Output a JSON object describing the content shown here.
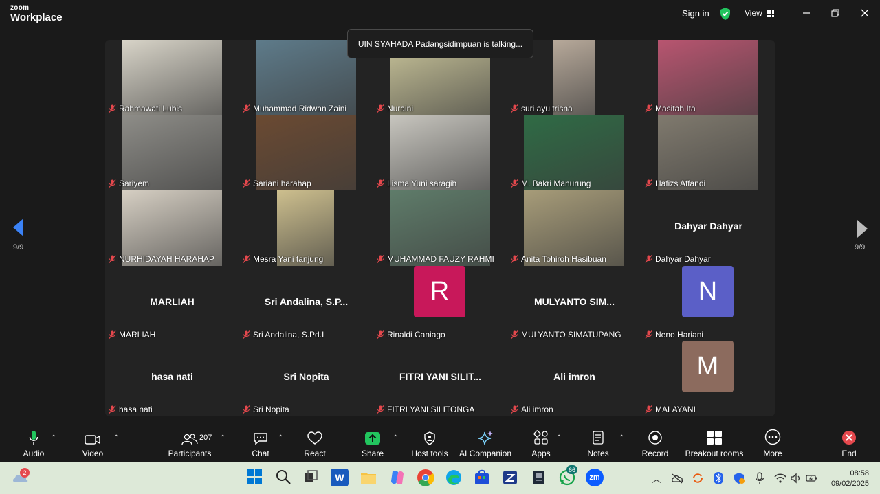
{
  "titlebar": {
    "logo_top": "zoom",
    "logo_bottom": "Workplace",
    "signin": "Sign in",
    "view": "View"
  },
  "toast": "UIN SYAHADA Padangsidimpuan is talking...",
  "pager": {
    "left": "9/9",
    "right": "9/9"
  },
  "tiles": [
    {
      "label": "Rahmawati Lubis",
      "kind": "video",
      "color": "#d8d4c8"
    },
    {
      "label": "Muhammad Ridwan Zaini",
      "kind": "video",
      "color": "#5e7b8a"
    },
    {
      "label": "Nuraini",
      "kind": "video",
      "color": "#c9c49a"
    },
    {
      "label": "suri ayu trisna",
      "kind": "video",
      "color": "#b7a99a"
    },
    {
      "label": "Masitah Ita",
      "kind": "video",
      "color": "#b85570"
    },
    {
      "label": "Sariyem",
      "kind": "video",
      "color": "#8e8d88"
    },
    {
      "label": "Sariani harahap",
      "kind": "video",
      "color": "#6b4a32"
    },
    {
      "label": "Lisma Yuni saragih",
      "kind": "video",
      "color": "#c8c6bf"
    },
    {
      "label": "M. Bakri Manurung",
      "kind": "video",
      "color": "#2f6b45"
    },
    {
      "label": "Hafizs Affandi",
      "kind": "video",
      "color": "#807a6e"
    },
    {
      "label": "NURHIDAYAH HARAHAP",
      "kind": "video",
      "color": "#d6cfc3"
    },
    {
      "label": "Mesra Yani tanjung",
      "kind": "video",
      "color": "#cdbf8e"
    },
    {
      "label": "MUHAMMAD FAUZY RAHMI",
      "kind": "video",
      "color": "#5f7c6a"
    },
    {
      "label": "Anita Tohiroh Hasibuan",
      "kind": "video",
      "color": "#a79c79"
    },
    {
      "label": "Dahyar Dahyar",
      "kind": "name",
      "display": "Dahyar Dahyar"
    },
    {
      "label": "MARLIAH",
      "kind": "name",
      "display": "MARLIAH"
    },
    {
      "label": "Sri Andalina, S.Pd.I",
      "kind": "name",
      "display": "Sri Andalina, S.P..."
    },
    {
      "label": "Rinaldi Caniago",
      "kind": "avatar",
      "letter": "R",
      "color": "#c8185a"
    },
    {
      "label": "MULYANTO SIMATUPANG",
      "kind": "name",
      "display": "MULYANTO SIM..."
    },
    {
      "label": "Neno Hariani",
      "kind": "avatar",
      "letter": "N",
      "color": "#5b5fc7"
    },
    {
      "label": "hasa nati",
      "kind": "name",
      "display": "hasa nati"
    },
    {
      "label": "Sri Nopita",
      "kind": "name",
      "display": "Sri Nopita"
    },
    {
      "label": "FITRI YANI SILITONGA",
      "kind": "name",
      "display": "FITRI YANI SILIT..."
    },
    {
      "label": "Ali imron",
      "kind": "name",
      "display": "Ali imron"
    },
    {
      "label": "MALAYANI",
      "kind": "avatar",
      "letter": "M",
      "color": "#8c6b5e"
    }
  ],
  "toolbar": {
    "audio": "Audio",
    "video": "Video",
    "participants": "Participants",
    "participants_count": "207",
    "chat": "Chat",
    "react": "React",
    "share": "Share",
    "host_tools": "Host tools",
    "ai_companion": "AI Companion",
    "apps": "Apps",
    "notes": "Notes",
    "record": "Record",
    "breakout": "Breakout rooms",
    "more": "More",
    "end": "End"
  },
  "taskbar": {
    "weather_badge": "2",
    "whatsapp_badge": "66",
    "zoom_label": "zm",
    "time": "08:58",
    "date": "09/02/2025"
  },
  "colors": {
    "share_green": "#22c55e",
    "end_red": "#e5484d",
    "shield_green": "#22c55e"
  }
}
